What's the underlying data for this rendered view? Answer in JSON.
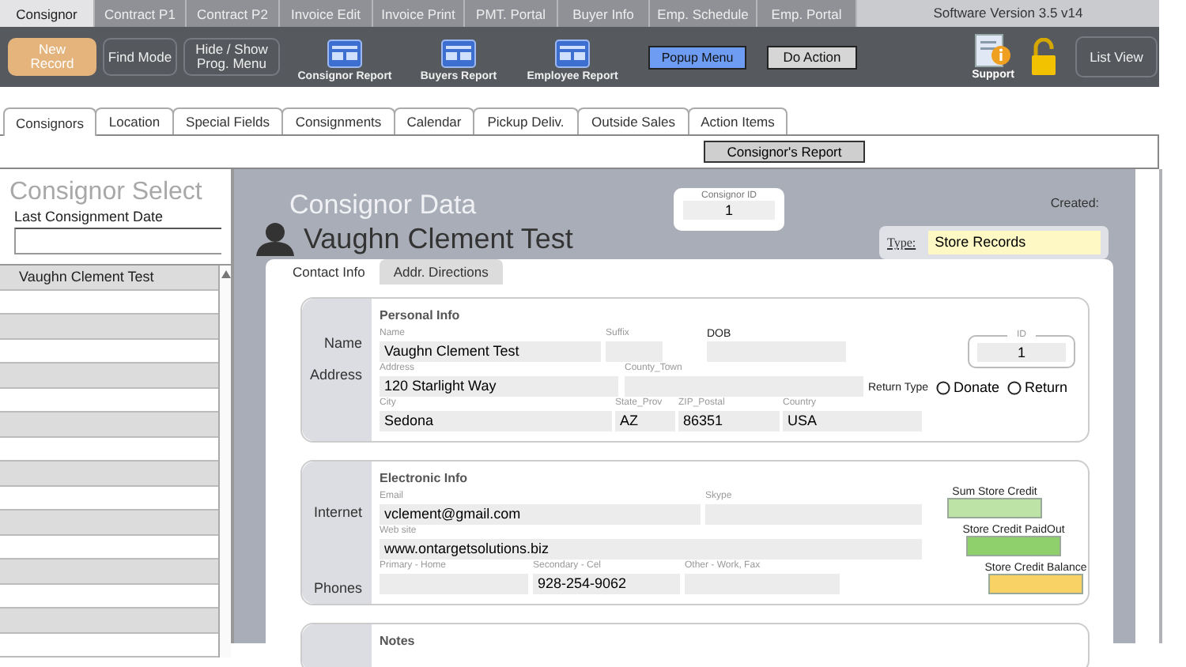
{
  "top_tabs": [
    {
      "label": "Consignor",
      "selected": true
    },
    {
      "label": "Contract P1",
      "selected": false
    },
    {
      "label": "Contract P2",
      "selected": false
    },
    {
      "label": "Invoice Edit",
      "selected": false
    },
    {
      "label": "Invoice Print",
      "selected": false
    },
    {
      "label": "PMT. Portal",
      "selected": false
    },
    {
      "label": "Buyer Info",
      "selected": false
    },
    {
      "label": "Emp. Schedule",
      "selected": false
    },
    {
      "label": "Emp. Portal",
      "selected": false
    }
  ],
  "version": "Software Version 3.5  v14",
  "toolbar": {
    "buttons": [
      {
        "label": "New Record",
        "kind": "accent"
      },
      {
        "label": "Find Mode",
        "kind": "plain"
      },
      {
        "label": "Hide / Show Prog. Menu",
        "kind": "plain"
      }
    ],
    "reports": [
      {
        "label": "Consignor Report"
      },
      {
        "label": "Buyers Report"
      },
      {
        "label": "Employee Report"
      }
    ],
    "popup_menu": "Popup Menu",
    "do_action": "Do Action",
    "support": "Support",
    "list_view": "List View"
  },
  "section_tabs": [
    {
      "label": "Consignors",
      "selected": true
    },
    {
      "label": "Location",
      "selected": false
    },
    {
      "label": "Special Fields",
      "selected": false
    },
    {
      "label": "Consignments",
      "selected": false
    },
    {
      "label": "Calendar",
      "selected": false
    },
    {
      "label": "Pickup Deliv.",
      "selected": false
    },
    {
      "label": "Outside Sales",
      "selected": false
    },
    {
      "label": "Action Items",
      "selected": false
    }
  ],
  "report_button": "Consignor's Report",
  "sidebar": {
    "title": "Consignor Select",
    "date_label": "Last Consignment Date",
    "rows": [
      {
        "name": "Vaughn Clement Test"
      }
    ]
  },
  "main": {
    "title": "Consignor Data",
    "name": "Vaughn Clement Test",
    "consignor_id": {
      "label": "Consignor ID",
      "value": "1"
    },
    "created_label": "Created:",
    "type": {
      "label": "Type:",
      "value": "Store Records"
    },
    "form_tabs": [
      {
        "label": "Contact Info",
        "selected": true
      },
      {
        "label": "Addr. Directions",
        "selected": false
      }
    ],
    "personal_info": {
      "title": "Personal Info",
      "side_labels": [
        "Name",
        "Address"
      ],
      "fields": [
        {
          "label": "Name",
          "value": "Vaughn Clement Test"
        },
        {
          "label": "Suffix"
        },
        {
          "label": "DOB",
          "kind": "strong"
        },
        {
          "label": "Address",
          "value": "120 Starlight Way"
        },
        {
          "label": "County_Town"
        },
        {
          "label": "City",
          "value": "Sedona"
        },
        {
          "label": "State_Prov",
          "value": "AZ"
        },
        {
          "label": "ZIP_Postal",
          "value": "86351"
        },
        {
          "label": "Country",
          "value": "USA"
        }
      ],
      "id": {
        "label": "ID",
        "value": "1"
      },
      "return_type": {
        "label": "Return Type",
        "options": [
          {
            "label": "Donate",
            "selected": false
          },
          {
            "label": "Return",
            "selected": false
          }
        ]
      }
    },
    "electronic_info": {
      "title": "Electronic Info",
      "side_labels": [
        "Internet",
        "Phones"
      ],
      "fields": [
        {
          "label": "Email",
          "value": "vclement@gmail.com"
        },
        {
          "label": "Skype"
        },
        {
          "label": "Web site",
          "value": "www.ontargetsolutions.biz"
        },
        {
          "label": "Primary - Home"
        },
        {
          "label": "Secondary - Cel",
          "value": "928-254-9062"
        },
        {
          "label": "Other - Work, Fax"
        }
      ],
      "credits": [
        {
          "label": "Sum Store Credit",
          "color": "#bde3a6"
        },
        {
          "label": "Store Credit PaidOut",
          "color": "#8fd06c"
        },
        {
          "label": "Store Credit Balance",
          "color": "#f8d264"
        }
      ]
    },
    "notes": {
      "title": "Notes"
    }
  }
}
